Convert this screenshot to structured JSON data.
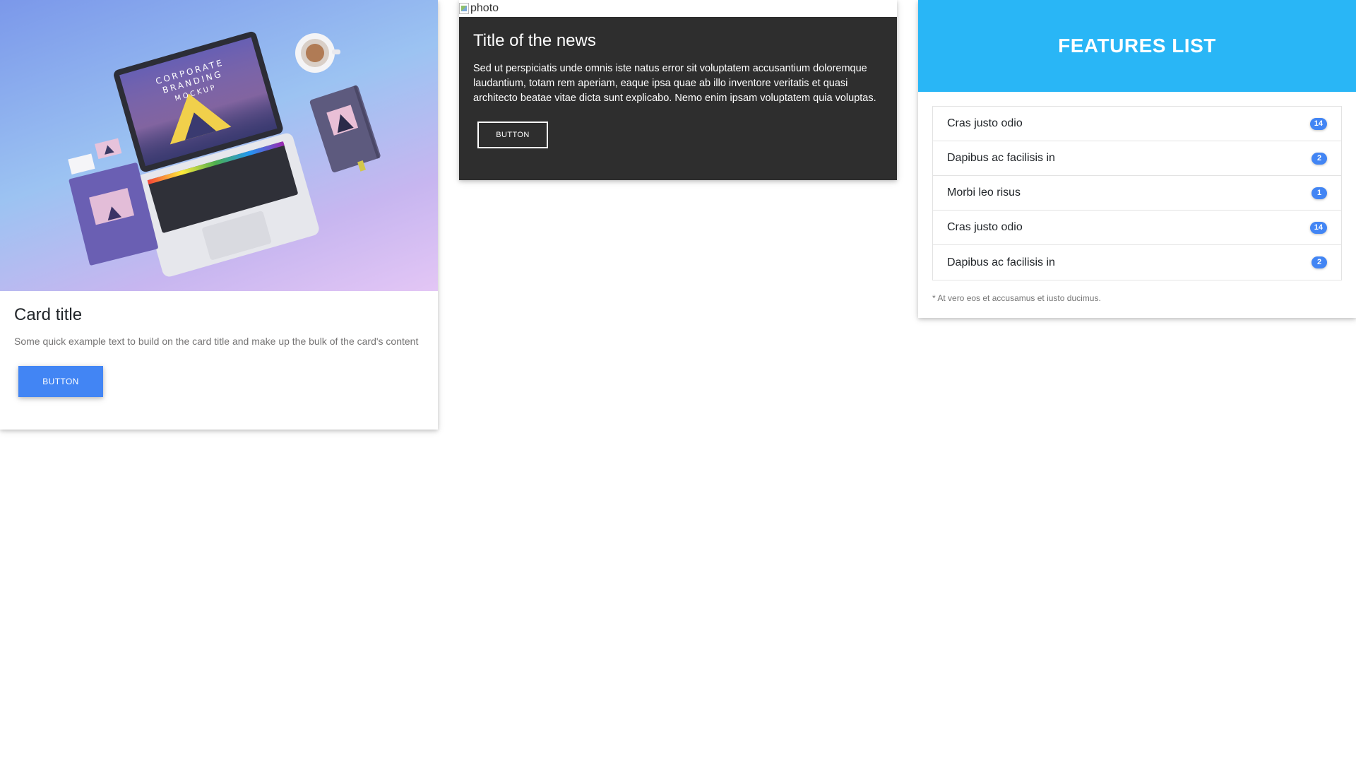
{
  "card1": {
    "image": {
      "laptop_screen_text": [
        "CORPORATE",
        "BRANDING",
        "MOCKUP"
      ]
    },
    "title": "Card title",
    "text": "Some quick example text to build on the card title and make up the bulk of the card's content",
    "button_label": "BUTTON",
    "colors": {
      "button": "#4285f4"
    }
  },
  "card2": {
    "image_alt": "photo",
    "title": "Title of the news",
    "text": "Sed ut perspiciatis unde omnis iste natus error sit voluptatem accusantium doloremque laudantium, totam rem aperiam, eaque ipsa quae ab illo inventore veritatis et quasi architecto beatae vitae dicta sunt explicabo. Nemo enim ipsam voluptatem quia voluptas.",
    "button_label": "BUTTON",
    "colors": {
      "background": "#2e2e2e"
    }
  },
  "card3": {
    "title": "FEATURES LIST",
    "items": [
      {
        "label": "Cras justo odio",
        "badge": "14"
      },
      {
        "label": "Dapibus ac facilisis in",
        "badge": "2"
      },
      {
        "label": "Morbi leo risus",
        "badge": "1"
      },
      {
        "label": "Cras justo odio",
        "badge": "14"
      },
      {
        "label": "Dapibus ac facilisis in",
        "badge": "2"
      }
    ],
    "footnote": "* At vero eos et accusamus et iusto ducimus.",
    "colors": {
      "header": "#29b6f6",
      "badge": "#4285f4"
    }
  }
}
